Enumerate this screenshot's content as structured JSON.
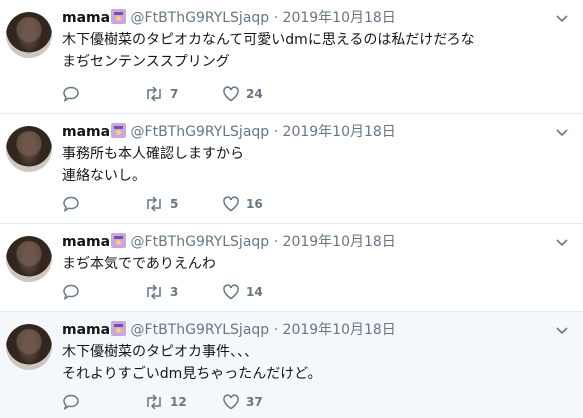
{
  "tweets": [
    {
      "name": "mama",
      "handle": "@FtBThG9RYLSjaqp",
      "sep": "·",
      "date": "2019年10月18日",
      "lines": [
        "木下優樹菜のタピオカなんて可愛いdmに思えるのは私だけだろな",
        "まぢセンテンススプリング"
      ],
      "retweets": "7",
      "likes": "24"
    },
    {
      "name": "mama",
      "handle": "@FtBThG9RYLSjaqp",
      "sep": "·",
      "date": "2019年10月18日",
      "lines": [
        "事務所も本人確認しますから",
        "連絡ないし。"
      ],
      "retweets": "5",
      "likes": "16"
    },
    {
      "name": "mama",
      "handle": "@FtBThG9RYLSjaqp",
      "sep": "·",
      "date": "2019年10月18日",
      "lines": [
        "まぢ本気ででありえんわ"
      ],
      "retweets": "3",
      "likes": "14"
    },
    {
      "name": "mama",
      "handle": "@FtBThG9RYLSjaqp",
      "sep": "·",
      "date": "2019年10月18日",
      "lines": [
        "木下優樹菜のタピオカ事件、、、",
        "それよりすごいdm見ちゃったんだけど。"
      ],
      "retweets": "12",
      "likes": "37"
    }
  ],
  "icons": {
    "reply": "reply-icon",
    "retweet": "retweet-icon",
    "like": "heart-icon",
    "more": "chevron-down-icon",
    "verified_like_badge": "emoji-badge"
  },
  "colors": {
    "text": "#14171a",
    "muted": "#657786",
    "divider": "#e6ecf0",
    "highlight": "#f5f8fa"
  }
}
